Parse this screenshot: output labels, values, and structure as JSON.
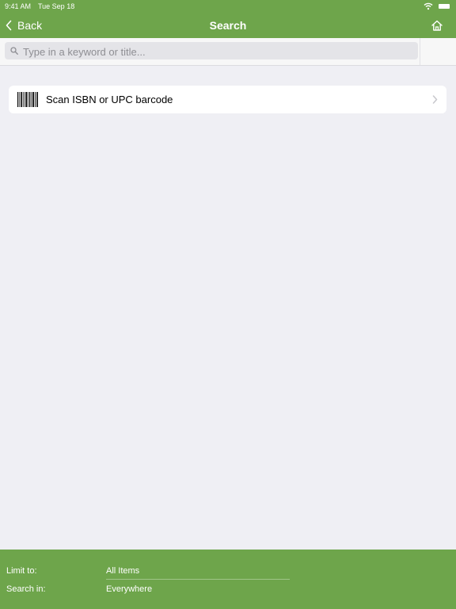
{
  "status_bar": {
    "time": "9:41 AM",
    "date": "Tue Sep 18"
  },
  "nav": {
    "back_label": "Back",
    "title": "Search"
  },
  "search": {
    "placeholder": "Type in a keyword or title...",
    "value": ""
  },
  "scan_cell": {
    "label": "Scan ISBN or UPC barcode"
  },
  "filters": {
    "limit_label": "Limit to:",
    "limit_value": "All Items",
    "search_in_label": "Search in:",
    "search_in_value": "Everywhere"
  },
  "colors": {
    "accent": "#6ea54b",
    "background": "#efeff4",
    "cell": "#ffffff",
    "search_field": "#e4e4e8"
  },
  "icons": {
    "back": "chevron-left-icon",
    "home": "home-icon",
    "search": "search-icon",
    "barcode": "barcode-icon",
    "disclosure": "chevron-right-icon",
    "wifi": "wifi-icon",
    "battery": "battery-icon"
  }
}
